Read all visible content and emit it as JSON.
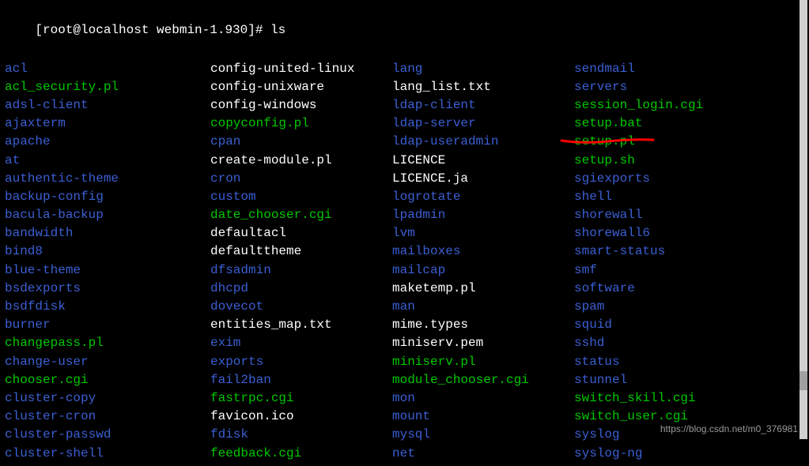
{
  "prompt": "[root@localhost webmin-1.930]# ls",
  "columns": [
    [
      {
        "name": "acl",
        "type": "dir"
      },
      {
        "name": "acl_security.pl",
        "type": "exec"
      },
      {
        "name": "adsl-client",
        "type": "dir"
      },
      {
        "name": "ajaxterm",
        "type": "dir"
      },
      {
        "name": "apache",
        "type": "dir"
      },
      {
        "name": "at",
        "type": "dir"
      },
      {
        "name": "authentic-theme",
        "type": "dir"
      },
      {
        "name": "backup-config",
        "type": "dir"
      },
      {
        "name": "bacula-backup",
        "type": "dir"
      },
      {
        "name": "bandwidth",
        "type": "dir"
      },
      {
        "name": "bind8",
        "type": "dir"
      },
      {
        "name": "blue-theme",
        "type": "dir"
      },
      {
        "name": "bsdexports",
        "type": "dir"
      },
      {
        "name": "bsdfdisk",
        "type": "dir"
      },
      {
        "name": "burner",
        "type": "dir"
      },
      {
        "name": "changepass.pl",
        "type": "exec"
      },
      {
        "name": "change-user",
        "type": "dir"
      },
      {
        "name": "chooser.cgi",
        "type": "exec"
      },
      {
        "name": "cluster-copy",
        "type": "dir"
      },
      {
        "name": "cluster-cron",
        "type": "dir"
      },
      {
        "name": "cluster-passwd",
        "type": "dir"
      },
      {
        "name": "cluster-shell",
        "type": "dir"
      }
    ],
    [
      {
        "name": "config-united-linux",
        "type": "file"
      },
      {
        "name": "config-unixware",
        "type": "file"
      },
      {
        "name": "config-windows",
        "type": "file"
      },
      {
        "name": "copyconfig.pl",
        "type": "exec"
      },
      {
        "name": "cpan",
        "type": "dir"
      },
      {
        "name": "create-module.pl",
        "type": "file"
      },
      {
        "name": "cron",
        "type": "dir"
      },
      {
        "name": "custom",
        "type": "dir"
      },
      {
        "name": "date_chooser.cgi",
        "type": "exec"
      },
      {
        "name": "defaultacl",
        "type": "file"
      },
      {
        "name": "defaulttheme",
        "type": "file"
      },
      {
        "name": "dfsadmin",
        "type": "dir"
      },
      {
        "name": "dhcpd",
        "type": "dir"
      },
      {
        "name": "dovecot",
        "type": "dir"
      },
      {
        "name": "entities_map.txt",
        "type": "file"
      },
      {
        "name": "exim",
        "type": "dir"
      },
      {
        "name": "exports",
        "type": "dir"
      },
      {
        "name": "fail2ban",
        "type": "dir"
      },
      {
        "name": "fastrpc.cgi",
        "type": "exec"
      },
      {
        "name": "favicon.ico",
        "type": "file"
      },
      {
        "name": "fdisk",
        "type": "dir"
      },
      {
        "name": "feedback.cgi",
        "type": "exec"
      }
    ],
    [
      {
        "name": "lang",
        "type": "dir"
      },
      {
        "name": "lang_list.txt",
        "type": "file"
      },
      {
        "name": "ldap-client",
        "type": "dir"
      },
      {
        "name": "ldap-server",
        "type": "dir"
      },
      {
        "name": "ldap-useradmin",
        "type": "dir"
      },
      {
        "name": "LICENCE",
        "type": "file"
      },
      {
        "name": "LICENCE.ja",
        "type": "file"
      },
      {
        "name": "logrotate",
        "type": "dir"
      },
      {
        "name": "lpadmin",
        "type": "dir"
      },
      {
        "name": "lvm",
        "type": "dir"
      },
      {
        "name": "mailboxes",
        "type": "dir"
      },
      {
        "name": "mailcap",
        "type": "dir"
      },
      {
        "name": "maketemp.pl",
        "type": "file"
      },
      {
        "name": "man",
        "type": "dir"
      },
      {
        "name": "mime.types",
        "type": "file"
      },
      {
        "name": "miniserv.pem",
        "type": "file"
      },
      {
        "name": "miniserv.pl",
        "type": "exec"
      },
      {
        "name": "module_chooser.cgi",
        "type": "exec"
      },
      {
        "name": "mon",
        "type": "dir"
      },
      {
        "name": "mount",
        "type": "dir"
      },
      {
        "name": "mysql",
        "type": "dir"
      },
      {
        "name": "net",
        "type": "dir"
      }
    ],
    [
      {
        "name": "sendmail",
        "type": "dir"
      },
      {
        "name": "servers",
        "type": "dir"
      },
      {
        "name": "session_login.cgi",
        "type": "exec"
      },
      {
        "name": "setup.bat",
        "type": "exec"
      },
      {
        "name": "setup.pl",
        "type": "exec"
      },
      {
        "name": "setup.sh",
        "type": "exec"
      },
      {
        "name": "sgiexports",
        "type": "dir"
      },
      {
        "name": "shell",
        "type": "dir"
      },
      {
        "name": "shorewall",
        "type": "dir"
      },
      {
        "name": "shorewall6",
        "type": "dir"
      },
      {
        "name": "smart-status",
        "type": "dir"
      },
      {
        "name": "smf",
        "type": "dir"
      },
      {
        "name": "software",
        "type": "dir"
      },
      {
        "name": "spam",
        "type": "dir"
      },
      {
        "name": "squid",
        "type": "dir"
      },
      {
        "name": "sshd",
        "type": "dir"
      },
      {
        "name": "status",
        "type": "dir"
      },
      {
        "name": "stunnel",
        "type": "dir"
      },
      {
        "name": "switch_skill.cgi",
        "type": "exec"
      },
      {
        "name": "switch_user.cgi",
        "type": "exec"
      },
      {
        "name": "syslog",
        "type": "dir"
      },
      {
        "name": "syslog-ng",
        "type": "dir"
      }
    ]
  ],
  "watermark": "https://blog.csdn.net/m0_376981",
  "highlight": "setup.sh",
  "underline_color": "#ff0000"
}
